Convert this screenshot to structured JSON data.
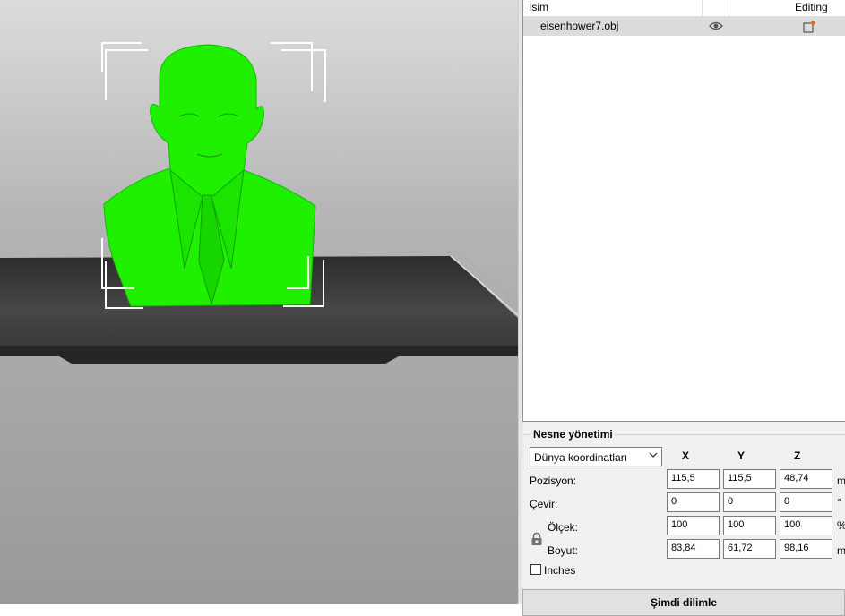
{
  "object_list": {
    "header_name": "İsim",
    "header_editing": "Editing",
    "items": [
      {
        "name": "eisenhower7.obj",
        "visible_icon": "eye-icon",
        "edit_icon": "edit-settings-icon"
      }
    ]
  },
  "manipulation": {
    "title": "Nesne yönetimi",
    "coordinate_system": "Dünya koordinatları",
    "axes": [
      "X",
      "Y",
      "Z"
    ],
    "rows": {
      "position": {
        "label": "Pozisyon:",
        "x": "115,5",
        "y": "115,5",
        "z": "48,74",
        "unit": "m"
      },
      "rotation": {
        "label": "Çevir:",
        "x": "0",
        "y": "0",
        "z": "0",
        "unit": "°"
      },
      "scale": {
        "label": "Ölçek:",
        "x": "100",
        "y": "100",
        "z": "100",
        "unit": "%"
      },
      "size": {
        "label": "Boyut:",
        "x": "83,84",
        "y": "61,72",
        "z": "98,16",
        "unit": "m"
      }
    },
    "inches_label": "Inches"
  },
  "slice_button": "Şimdi dilimle",
  "colors": {
    "model": "#1ef000",
    "bed": "#3c3c3c",
    "selection_box": "#ffffff"
  }
}
